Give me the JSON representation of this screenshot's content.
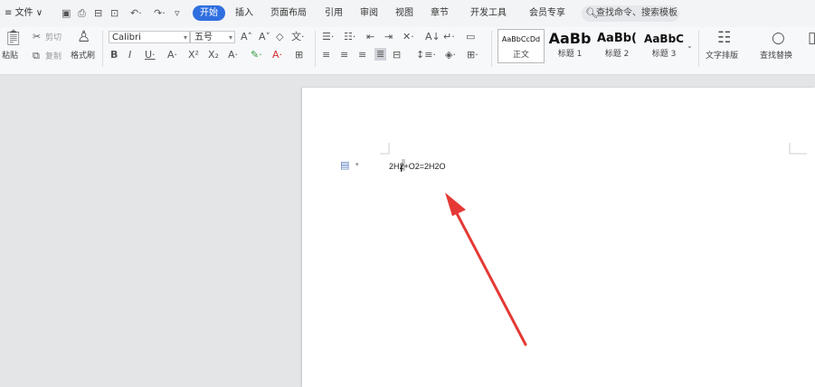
{
  "menu": {
    "file_label": "≡ 文件 ∨",
    "tabs": [
      "插入",
      "页面布局",
      "引用",
      "审阅",
      "视图",
      "章节",
      "开发工具",
      "会员专享"
    ],
    "active_tab": "开始",
    "search_placeholder": "查找命令、搜索模板"
  },
  "ribbon": {
    "paste": "粘贴",
    "cut": "剪切",
    "copy": "复制",
    "format_painter": "格式刷",
    "font_name": "Calibri",
    "font_size": "五号",
    "styles": [
      {
        "sample": "AaBbCcDd",
        "name": "正文"
      },
      {
        "sample": "AaBb",
        "name": "标题 1"
      },
      {
        "sample": "AaBb(",
        "name": "标题 2"
      },
      {
        "sample": "AaBbC",
        "name": "标题 3"
      }
    ],
    "text_layout": "文字排版",
    "find_replace": "查找替换"
  },
  "document": {
    "text": "2H2+O2=2H2O"
  },
  "colors": {
    "accent": "#2f6fe0",
    "arrow": "#e53935"
  }
}
